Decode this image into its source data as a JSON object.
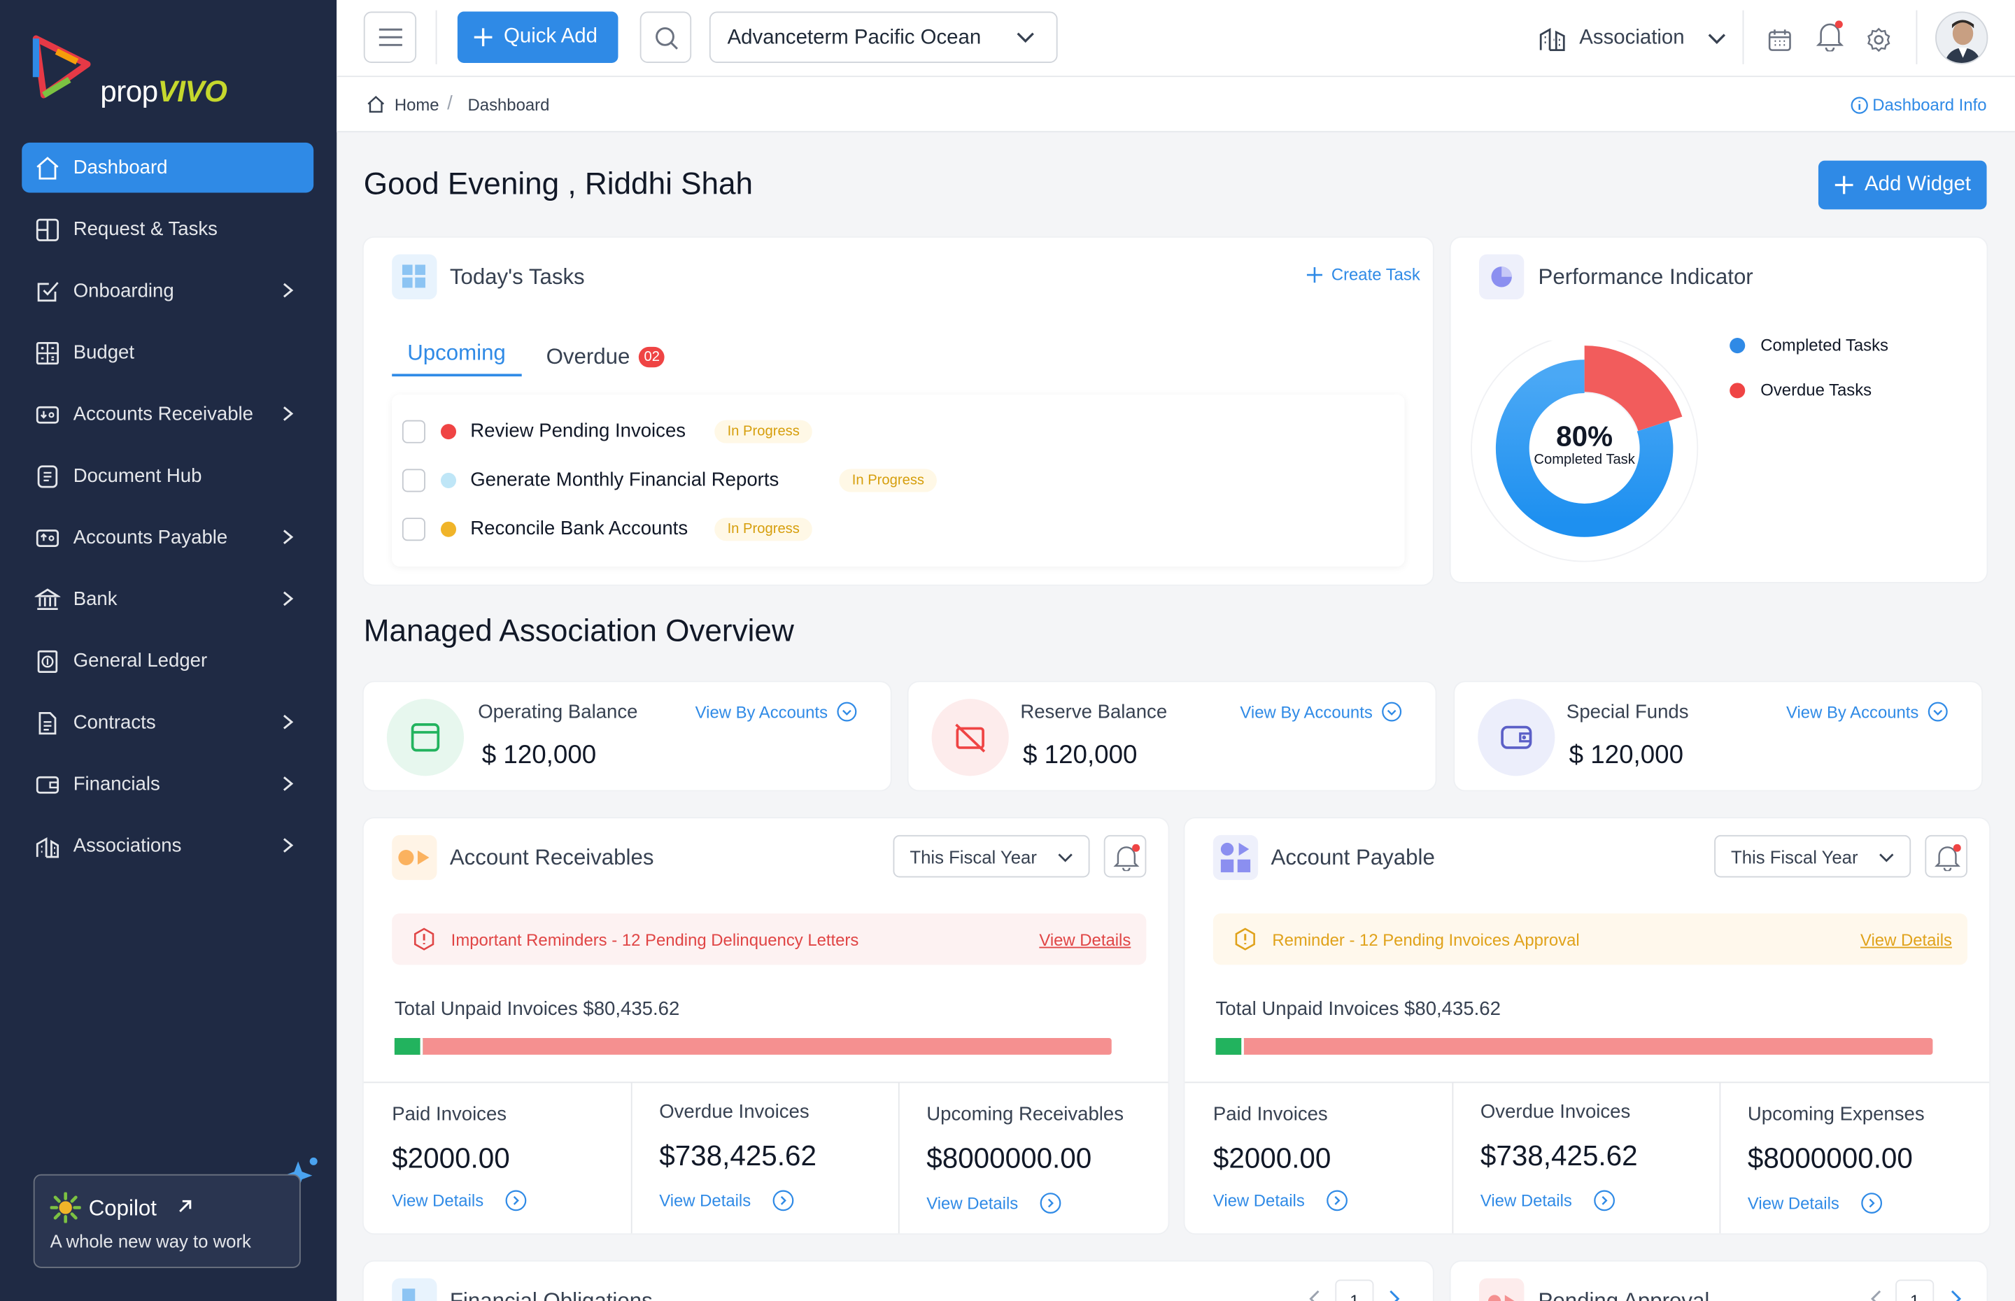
{
  "app": {
    "brand_prefix": "prop",
    "brand_suffix": "VIVO"
  },
  "sidebar": {
    "items": [
      {
        "label": "Dashboard",
        "icon": "home-icon",
        "active": true,
        "chevron": false
      },
      {
        "label": "Request & Tasks",
        "icon": "tasks-icon",
        "active": false,
        "chevron": false
      },
      {
        "label": "Onboarding",
        "icon": "onboarding-icon",
        "active": false,
        "chevron": true
      },
      {
        "label": "Budget",
        "icon": "budget-icon",
        "active": false,
        "chevron": false
      },
      {
        "label": "Accounts Receivable",
        "icon": "receivable-icon",
        "active": false,
        "chevron": true
      },
      {
        "label": "Document Hub",
        "icon": "document-icon",
        "active": false,
        "chevron": false
      },
      {
        "label": "Accounts Payable",
        "icon": "payable-icon",
        "active": false,
        "chevron": true
      },
      {
        "label": "Bank",
        "icon": "bank-icon",
        "active": false,
        "chevron": true
      },
      {
        "label": "General Ledger",
        "icon": "ledger-icon",
        "active": false,
        "chevron": false
      },
      {
        "label": "Contracts",
        "icon": "contract-icon",
        "active": false,
        "chevron": true
      },
      {
        "label": "Financials",
        "icon": "financials-icon",
        "active": false,
        "chevron": true
      },
      {
        "label": "Associations",
        "icon": "associations-icon",
        "active": false,
        "chevron": true
      }
    ],
    "copilot": {
      "title": "Copilot",
      "subtitle": "A whole new way to work"
    }
  },
  "topbar": {
    "quick_add": "Quick Add",
    "property_select": "Advanceterm Pacific Ocean",
    "association": "Association"
  },
  "breadcrumb": {
    "home": "Home",
    "current": "Dashboard",
    "info": "Dashboard Info"
  },
  "greeting": "Good Evening , Riddhi Shah",
  "add_widget": "Add Widget",
  "tasks": {
    "title": "Today's Tasks",
    "create": "Create Task",
    "tab_upcoming": "Upcoming",
    "tab_overdue": "Overdue",
    "overdue_count": "02",
    "items": [
      {
        "name": "Review Pending Invoices",
        "status": "In Progress",
        "color": "#ef4444"
      },
      {
        "name": "Generate Monthly Financial Reports",
        "status": "In Progress",
        "color": "#bfe6f7"
      },
      {
        "name": "Reconcile Bank Accounts",
        "status": "In Progress",
        "color": "#f0b429"
      }
    ]
  },
  "performance": {
    "title": "Performance Indicator",
    "percent": "80%",
    "center_label": "Completed Task",
    "completed_fraction": 0.8,
    "legend": [
      {
        "label": "Completed Tasks",
        "color": "#2f8ae6"
      },
      {
        "label": "Overdue Tasks",
        "color": "#ef4444"
      }
    ]
  },
  "overview": {
    "title": "Managed Association Overview",
    "cards": [
      {
        "label": "Operating Balance",
        "value": "$ 120,000",
        "link": "View By Accounts"
      },
      {
        "label": "Reserve Balance",
        "value": "$ 120,000",
        "link": "View By Accounts"
      },
      {
        "label": "Special Funds",
        "value": "$ 120,000",
        "link": "View By Accounts"
      }
    ]
  },
  "receivables": {
    "title": "Account Receivables",
    "period": "This Fiscal Year",
    "alert": "Important Reminders - 12 Pending Delinquency Letters",
    "alert_link": "View Details",
    "total": "Total Unpaid Invoices $80,435.62",
    "paid_fraction": 0.04,
    "stats": [
      {
        "label": "Paid Invoices",
        "value": "$2000.00",
        "link": "View Details"
      },
      {
        "label": "Overdue Invoices",
        "value": "$738,425.62",
        "link": "View Details"
      },
      {
        "label": "Upcoming Receivables",
        "value": "$8000000.00",
        "link": "View Details"
      }
    ]
  },
  "payable": {
    "title": "Account Payable",
    "period": "This Fiscal Year",
    "alert": "Reminder - 12 Pending Invoices Approval",
    "alert_link": "View Details",
    "total": "Total Unpaid Invoices $80,435.62",
    "paid_fraction": 0.04,
    "stats": [
      {
        "label": "Paid Invoices",
        "value": "$2000.00",
        "link": "View Details"
      },
      {
        "label": "Overdue Invoices",
        "value": "$738,425.62",
        "link": "View Details"
      },
      {
        "label": "Upcoming Expenses",
        "value": "$8000000.00",
        "link": "View Details"
      }
    ]
  },
  "bottom": {
    "left_title": "Financial Obligations",
    "right_title": "Pending Approval",
    "page": "1"
  }
}
